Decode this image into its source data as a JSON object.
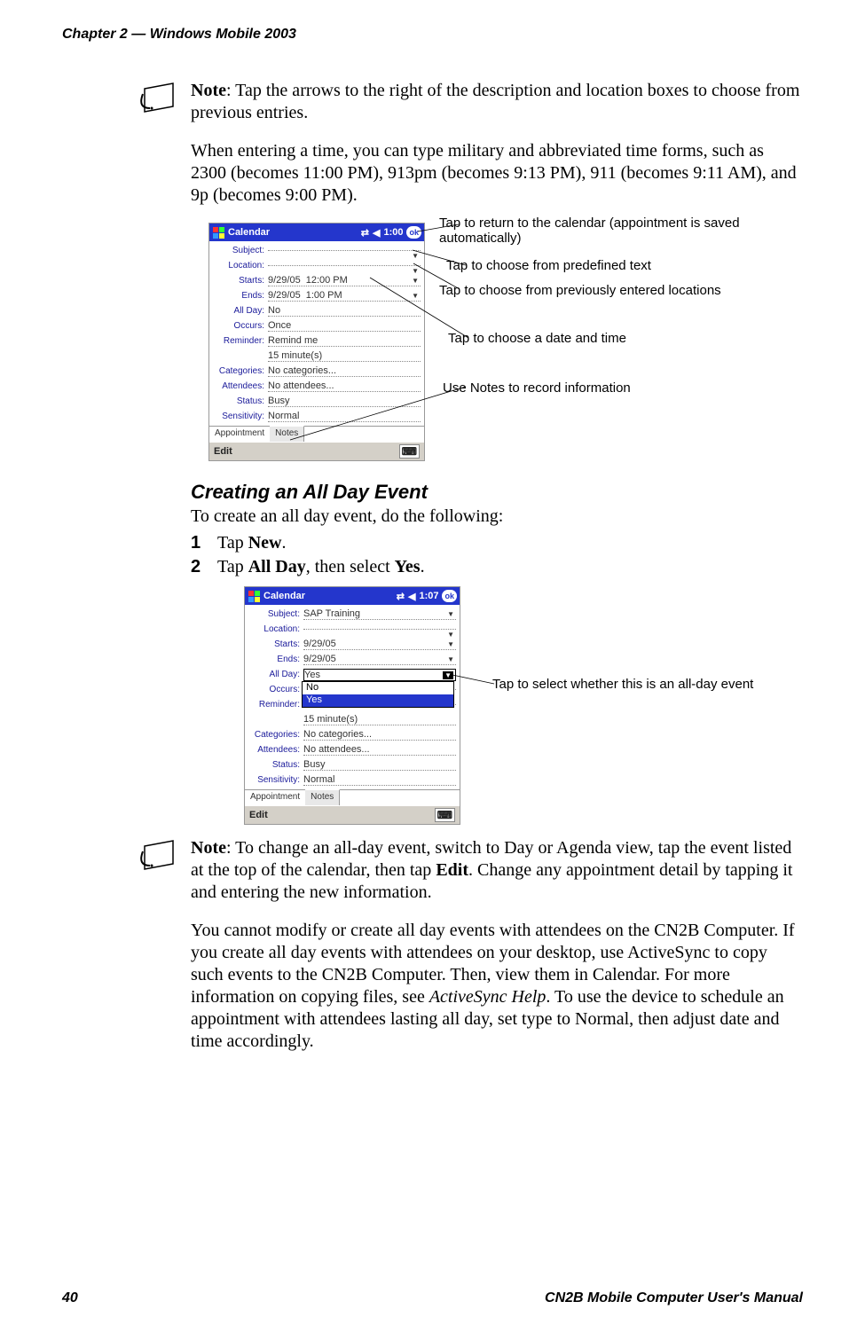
{
  "header": "Chapter 2 — Windows Mobile 2003",
  "footer_left": "40",
  "footer_right": "CN2B Mobile Computer User's Manual",
  "note1_label": "Note",
  "note1_text": ": Tap the arrows to the right of the description and location boxes to choose from previous entries.",
  "para1": "When entering a time, you can type military and abbreviated time forms, such as 2300 (becomes 11:00 PM), 913pm (becomes 9:13 PM), 911 (becomes 9:11 AM), and 9p (becomes 9:00 PM).",
  "sec_heading": "Creating an All Day Event",
  "sec_intro": "To create an all day event, do the following:",
  "step1_num": "1",
  "step1_a": "Tap ",
  "step1_b": "New",
  "step1_c": ".",
  "step2_num": "2",
  "step2_a": "Tap ",
  "step2_b": "All Day",
  "step2_c": ", then select ",
  "step2_d": "Yes",
  "step2_e": ".",
  "note2_label": "Note",
  "note2_a": ": To change an all-day event, switch to Day or Agenda view, tap the event listed at the top of the calendar, then tap ",
  "note2_b": "Edit",
  "note2_c": ". Change any appointment detail by tapping it and entering the new information.",
  "para2_a": "You cannot modify or create all day events with attendees on the CN2B Computer. If you create all day events with attendees on your desktop, use ActiveSync to copy such events to the CN2B Computer. Then, view them in Calendar. For more information on copying files, see ",
  "para2_b": "ActiveSync Help",
  "para2_c": ". To use the device to schedule an appointment with attendees lasting all day, set type to Normal, then adjust date and time accordingly.",
  "dev1": {
    "app": "Calendar",
    "time": "1:00",
    "ok": "ok",
    "edit": "Edit",
    "tab_appt": "Appointment",
    "tab_notes": "Notes",
    "labels": {
      "subject": "Subject:",
      "location": "Location:",
      "starts": "Starts:",
      "ends": "Ends:",
      "allday": "All Day:",
      "occurs": "Occurs:",
      "reminder": "Reminder:",
      "rem2": "",
      "categories": "Categories:",
      "attendees": "Attendees:",
      "status": "Status:",
      "sensitivity": "Sensitivity:"
    },
    "values": {
      "subject": "",
      "location": "",
      "starts_date": "9/29/05",
      "starts_time": "12:00 PM",
      "ends_date": "9/29/05",
      "ends_time": "1:00 PM",
      "allday": "No",
      "occurs": "Once",
      "reminder": "Remind me",
      "rem2": "15   minute(s)",
      "categories": "No categories...",
      "attendees": "No attendees...",
      "status": "Busy",
      "sensitivity": "Normal"
    }
  },
  "dev2": {
    "app": "Calendar",
    "time": "1:07",
    "ok": "ok",
    "edit": "Edit",
    "tab_appt": "Appointment",
    "tab_notes": "Notes",
    "labels": {
      "subject": "Subject:",
      "location": "Location:",
      "starts": "Starts:",
      "ends": "Ends:",
      "allday": "All Day:",
      "occurs": "Occurs:",
      "reminder": "Reminder:",
      "rem2": "",
      "categories": "Categories:",
      "attendees": "Attendees:",
      "status": "Status:",
      "sensitivity": "Sensitivity:"
    },
    "values": {
      "subject": "SAP Training",
      "location": "",
      "starts_date": "9/29/05",
      "ends_date": "9/29/05",
      "allday": "Yes",
      "occurs": "",
      "reminder": "",
      "rem2": "15   minute(s)",
      "categories": "No categories...",
      "attendees": "No attendees...",
      "status": "Busy",
      "sensitivity": "Normal"
    },
    "popup": {
      "opt_no": "No",
      "opt_yes": "Yes"
    }
  },
  "call": {
    "ok": "Tap to return to the calendar (appointment is saved automatically)",
    "subject": "Tap to choose from predefined text",
    "location": "Tap to choose from previously entered locations",
    "starts": "Tap to choose a date and time",
    "notes": "Use Notes to record information",
    "allday": "Tap to select whether this is an all-day event"
  }
}
